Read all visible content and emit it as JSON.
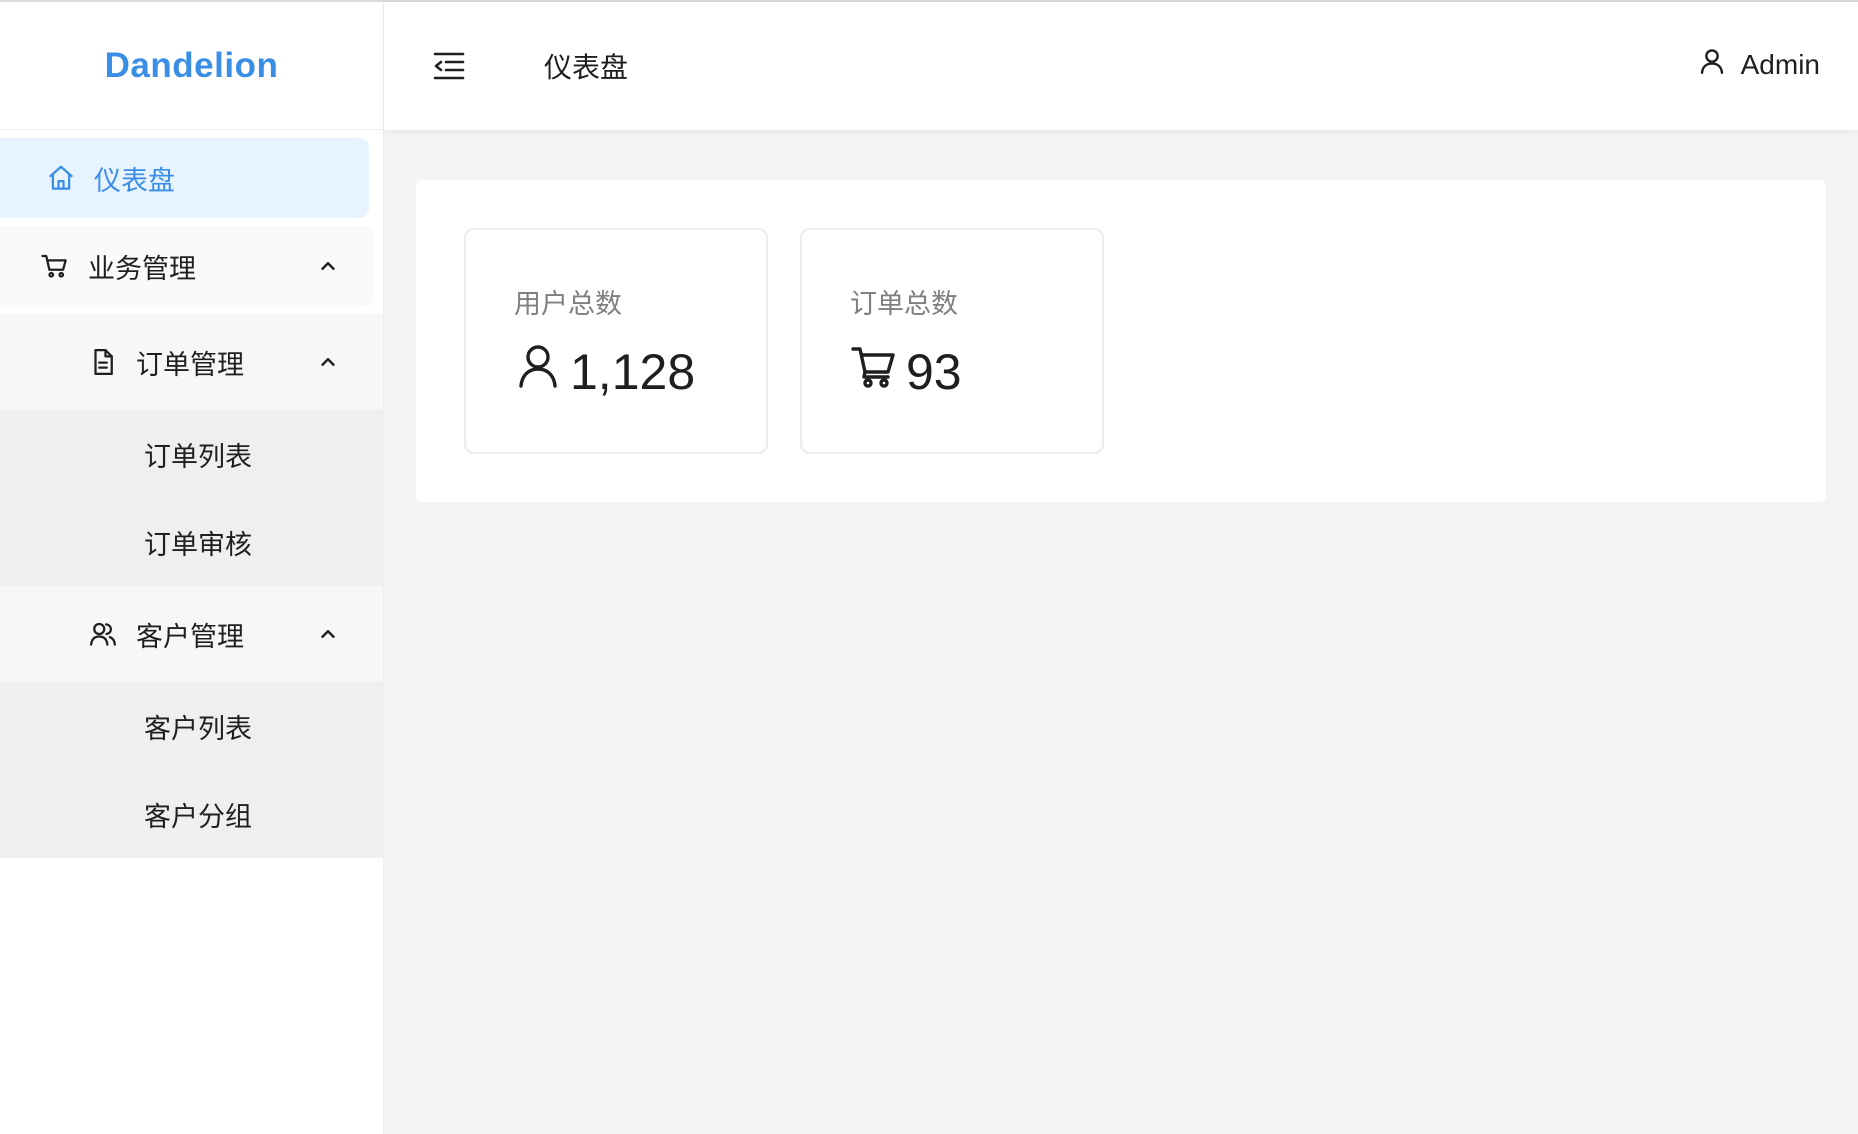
{
  "app": {
    "brand": "Dandelion",
    "brand_color": "#3a8ee6"
  },
  "header": {
    "toggle_icon": "menu-fold-icon",
    "title": "仪表盘",
    "user_icon": "user-icon",
    "user_name": "Admin"
  },
  "sidebar": {
    "dashboard": {
      "label": "仪表盘",
      "icon": "home-icon",
      "selected": true
    },
    "business": {
      "label": "业务管理",
      "icon": "cart-icon",
      "expanded": true,
      "groups": [
        {
          "label": "订单管理",
          "icon": "document-icon",
          "expanded": true,
          "items": [
            {
              "label": "订单列表"
            },
            {
              "label": "订单审核"
            }
          ]
        },
        {
          "label": "客户管理",
          "icon": "users-icon",
          "expanded": true,
          "items": [
            {
              "label": "客户列表"
            },
            {
              "label": "客户分组"
            }
          ]
        }
      ]
    }
  },
  "stats": [
    {
      "title": "用户总数",
      "value": "1,128",
      "icon": "user-icon"
    },
    {
      "title": "订单总数",
      "value": "93",
      "icon": "cart-icon"
    }
  ]
}
